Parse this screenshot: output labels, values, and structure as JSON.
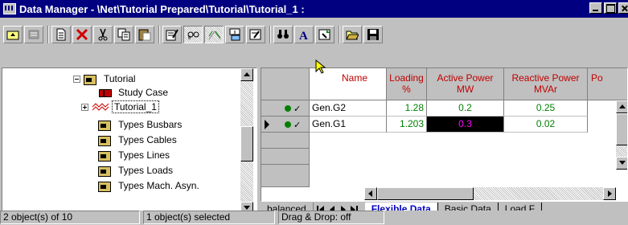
{
  "window": {
    "title": "Data Manager - \\Net\\Tutorial Prepared\\Tutorial\\Tutorial_1 :"
  },
  "toolbar": {
    "buttons": [
      "up-folder",
      "detail-view",
      "new-object",
      "delete",
      "cut",
      "copy",
      "paste",
      "edit-properties",
      "show-graphic",
      "filter",
      "new-element",
      "edit-record",
      "find",
      "font",
      "select",
      "open",
      "save"
    ]
  },
  "tree": {
    "items": [
      {
        "label": "Tutorial",
        "icon": "folder-icon",
        "expander": "minus"
      },
      {
        "label": "Study Case",
        "icon": "study-case-icon"
      },
      {
        "label": "Tutorial_1",
        "icon": "grid-icon",
        "expander": "plus"
      },
      {
        "label": "Types Busbars",
        "icon": "folder-icon"
      },
      {
        "label": "Types Cables",
        "icon": "folder-icon"
      },
      {
        "label": "Types Lines",
        "icon": "folder-icon"
      },
      {
        "label": "Types Loads",
        "icon": "folder-icon"
      },
      {
        "label": "Types Mach. Asyn.",
        "icon": "folder-icon"
      }
    ]
  },
  "grid": {
    "columns": [
      {
        "label": "Name",
        "unit": ""
      },
      {
        "label": "Loading",
        "unit": "%"
      },
      {
        "label": "Active Power",
        "unit": "MW"
      },
      {
        "label": "Reactive Power",
        "unit": "MVAr"
      },
      {
        "label": "Po",
        "unit": ""
      }
    ],
    "rows": [
      {
        "current": false,
        "check": "✓",
        "name": "Gen.G2",
        "loading": "1.28",
        "active_power": "0.2",
        "reactive_power": "0.25"
      },
      {
        "current": true,
        "check": "✓",
        "name": "Gen.G1",
        "loading": "1.203",
        "active_power": "0.3",
        "reactive_power": "0.02"
      }
    ]
  },
  "tabs": {
    "left_label": "balanced",
    "items": [
      {
        "label": "Flexible Data",
        "active": true
      },
      {
        "label": "Basic Data",
        "active": false
      },
      {
        "label": "Load F",
        "active": false
      }
    ]
  },
  "status": {
    "object_count": "2 object(s) of 10",
    "selected": "1 object(s) selected",
    "drag_drop": "Drag & Drop: off"
  },
  "colors": {
    "title_bar": "#000080",
    "header_text": "#c00000",
    "value_text": "#008000",
    "selected_cell_bg": "#000000",
    "selected_cell_text": "#ff00ff"
  }
}
